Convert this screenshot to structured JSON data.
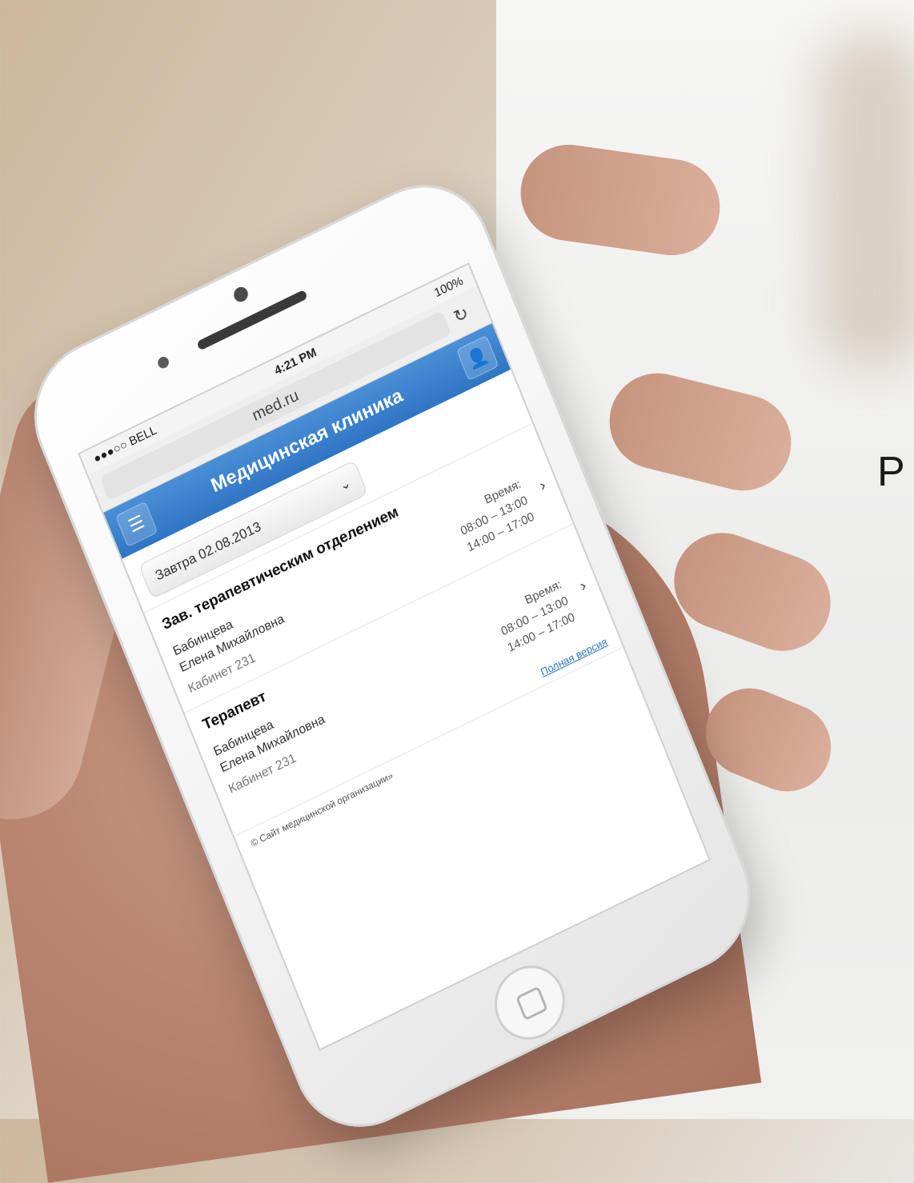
{
  "side_text": "Р",
  "status_bar": {
    "carrier": "●●●○○ BELL",
    "time": "4:21 PM",
    "battery": "100%"
  },
  "browser": {
    "url": "med.ru",
    "reload_icon": "reload-icon"
  },
  "app": {
    "title": "Медицинская клиника"
  },
  "date_select": {
    "value": "Завтра 02.08.2013"
  },
  "entries": [
    {
      "role": "Зав. терапевтическим отделением",
      "last_name": "Бабинцева",
      "name": "Елена Михайловна",
      "room": "Кабинет 231",
      "time_label": "Время:",
      "time1": "08:00 – 13:00",
      "time2": "14:00 – 17:00"
    },
    {
      "role": "Терапевт",
      "last_name": "Бабинцева",
      "name": "Елена Михайловна",
      "room": "Кабинет 231",
      "time_label": "Время:",
      "time1": "08:00 – 13:00",
      "time2": "14:00 – 17:00"
    }
  ],
  "full_version_link": "Полная версия",
  "footer": "© Сайт медицинской организации»"
}
